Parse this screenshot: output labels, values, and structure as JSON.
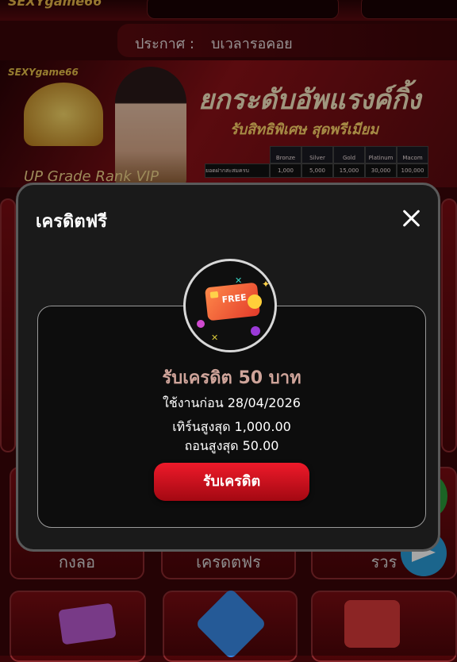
{
  "header": {
    "logo_text": "SEXYgame66"
  },
  "announcement": {
    "label": "ประกาศ :",
    "text": "บเวลารอคอย"
  },
  "banner": {
    "logo_text": "SEXYgame66",
    "title": "ยกระดับอัพแรงค์กิ้ง",
    "subtitle": "รับสิทธิพิเศษ สุดพรีเมียม",
    "rank_caption": "UP Grade Rank VIP",
    "rank_table": {
      "row_label": "ยอดฝากสะสมครบ",
      "columns": [
        {
          "name": "Bronze",
          "value": "1,000"
        },
        {
          "name": "Silver",
          "value": "5,000"
        },
        {
          "name": "Gold",
          "value": "15,000"
        },
        {
          "name": "Platinum",
          "value": "30,000"
        },
        {
          "name": "Macom",
          "value": "100,000"
        }
      ]
    }
  },
  "background_tiles": [
    {
      "label": "กงลอ"
    },
    {
      "label": "เครดตฟร"
    },
    {
      "label": "รวร"
    }
  ],
  "modal": {
    "title": "เครดิตฟรี",
    "icon_text": "FREE",
    "credit_title": "รับเครดิต 50 บาท",
    "use_before": "ใช้งานก่อน 28/04/2026",
    "turnover": "เทิร์นสูงสุด 1,000.00",
    "withdraw": "ถอนสูงสุด 50.00",
    "claim_button": "รับเครดิต"
  },
  "colors": {
    "accent_red": "#ee1a2a",
    "credit_title": "#cfa49a",
    "modal_bg": "#1a1a1a"
  }
}
